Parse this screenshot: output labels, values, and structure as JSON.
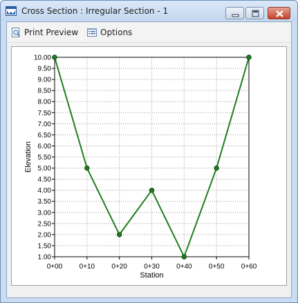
{
  "window": {
    "title": "Cross Section : Irregular Section - 1",
    "icon": "cross-section-app-icon"
  },
  "toolbar": {
    "print_preview_label": "Print Preview",
    "print_preview_icon": "print-preview-icon",
    "options_label": "Options",
    "options_icon": "options-icon"
  },
  "chart_data": {
    "type": "line",
    "xlabel": "Station",
    "ylabel": "Elevation",
    "x_tick_labels": [
      "0+00",
      "0+10",
      "0+20",
      "0+30",
      "0+40",
      "0+50",
      "0+60"
    ],
    "y_tick_labels": [
      "1.00",
      "1.50",
      "2.00",
      "2.50",
      "3.00",
      "3.50",
      "4.00",
      "4.50",
      "5.00",
      "5.50",
      "6.00",
      "6.50",
      "7.00",
      "7.50",
      "8.00",
      "8.50",
      "9.00",
      "9.50",
      "10.00"
    ],
    "xlim": [
      0,
      60
    ],
    "ylim": [
      1,
      10
    ],
    "grid": true,
    "series": [
      {
        "color": "#1e7d1e",
        "x": [
          0,
          10,
          20,
          30,
          40,
          50,
          60
        ],
        "y": [
          10.0,
          5.0,
          2.0,
          4.0,
          1.0,
          5.0,
          10.0
        ]
      }
    ]
  }
}
